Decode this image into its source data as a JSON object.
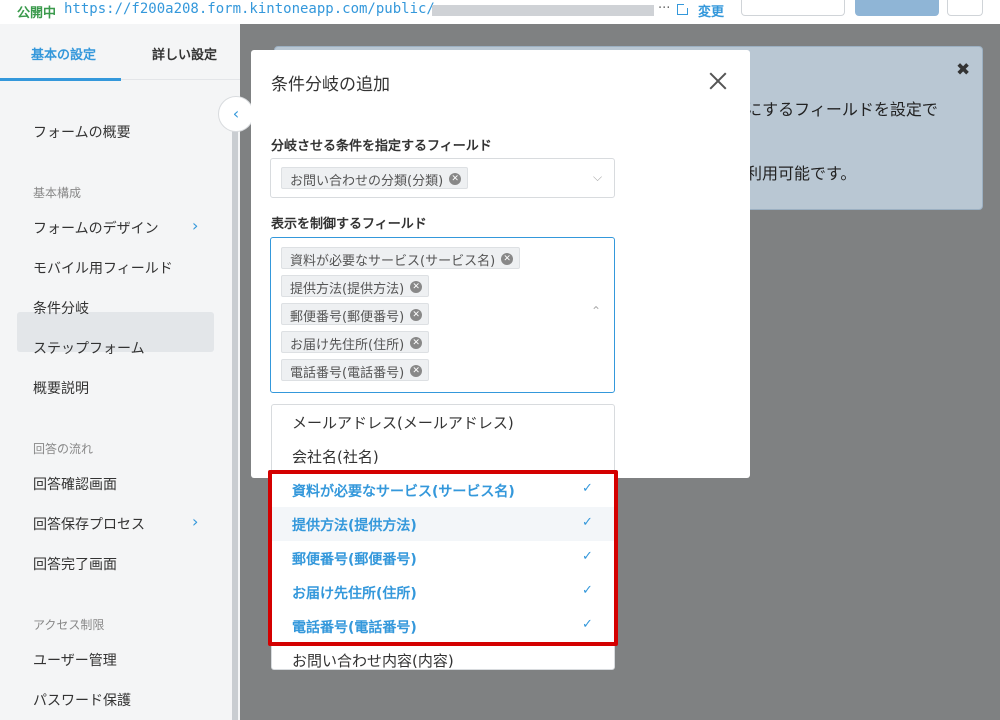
{
  "topbar": {
    "status_badge": "公開中",
    "url": "https://f200a208.form.kintoneapp.com/public/",
    "ellipsis": "···",
    "change_link": "変更"
  },
  "sidebar": {
    "tabs": [
      "基本の設定",
      "詳しい設定"
    ],
    "items": {
      "overview": "フォームの概要",
      "group_basic": "基本構成",
      "design": "フォームのデザイン",
      "mobile": "モバイル用フィールド",
      "conditional": "条件分岐",
      "step": "ステップフォーム",
      "summary": "概要説明",
      "group_flow": "回答の流れ",
      "confirm": "回答確認画面",
      "save_process": "回答保存プロセス",
      "complete": "回答完了画面",
      "group_access": "アクセス制限",
      "users": "ユーザー管理",
      "password": "パスワード保護"
    },
    "chevron": "›",
    "collapse": "‹"
  },
  "notice": {
    "text1": "にするフィールドを設定で",
    "text2": "利用可能です。",
    "close": "✖"
  },
  "modal": {
    "title": "条件分岐の追加",
    "condition_label": "分岐させる条件を指定するフィールド",
    "condition_chips": [
      "お問い合わせの分類(分類)"
    ],
    "display_label": "表示を制御するフィールド",
    "display_chips": [
      "資料が必要なサービス(サービス名)",
      "提供方法(提供方法)",
      "郵便番号(郵便番号)",
      "お届け先住所(住所)",
      "電話番号(電話番号)"
    ]
  },
  "dropdown": {
    "options_plain_top": [
      "メールアドレス(メールアドレス)",
      "会社名(社名)"
    ],
    "options_selected": [
      "資料が必要なサービス(サービス名)",
      "提供方法(提供方法)",
      "郵便番号(郵便番号)",
      "お届け先住所(住所)",
      "電話番号(電話番号)"
    ],
    "options_plain_bottom": [
      "お問い合わせ内容(内容)"
    ],
    "check": "✓"
  }
}
